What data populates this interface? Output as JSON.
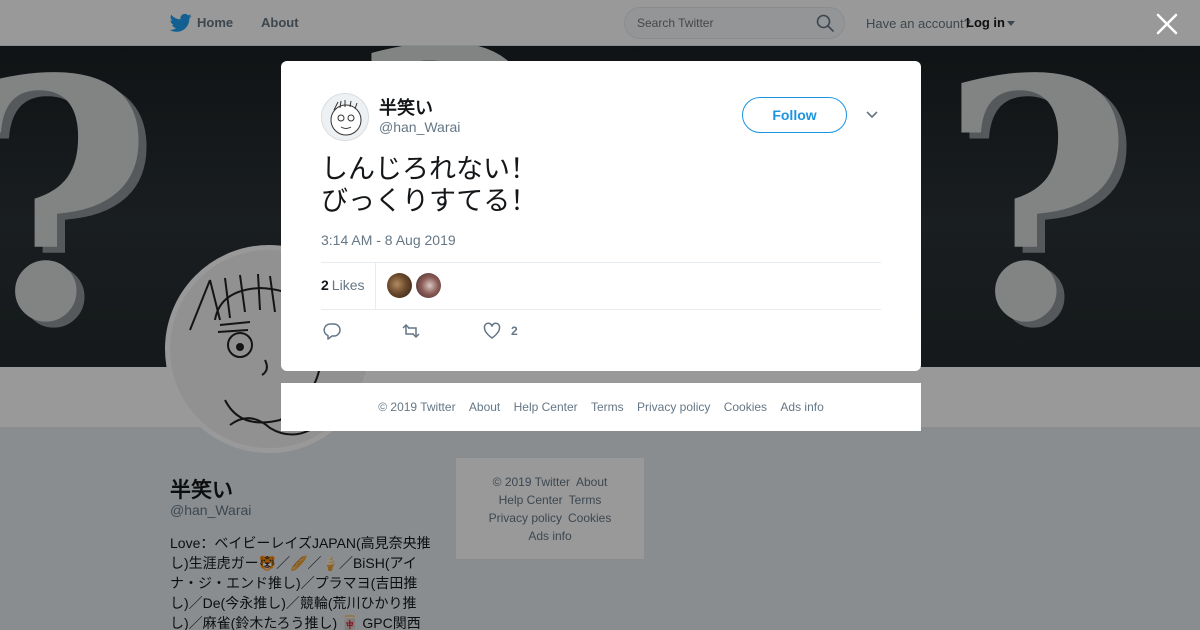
{
  "nav": {
    "home": "Home",
    "about": "About",
    "search_placeholder": "Search Twitter",
    "have_account": "Have an account?",
    "login": "Log in"
  },
  "profile": {
    "name": "半笑い",
    "handle": "@han_Warai",
    "bio": "Love：ベイビーレイズJAPAN(高見奈央推し)生涯虎ガー🐯／🥖／🍦／BiSH(アイナ・ジ・エンド推し)／プラマヨ(吉田推し)／De(今永推し)／競輪(荒川ひかり推し)／麻雀(鈴木たろう推し) 🀄 GPC関西"
  },
  "side_footer": {
    "row1": [
      "© 2019 Twitter",
      "About"
    ],
    "row2": [
      "Help Center",
      "Terms"
    ],
    "row3": [
      "Privacy policy",
      "Cookies"
    ],
    "row4": [
      "Ads info"
    ]
  },
  "tweet": {
    "name": "半笑い",
    "handle": "@han_Warai",
    "follow_label": "Follow",
    "text_line1": "しんじろれない！",
    "text_line2": "びっくりすてる！",
    "timestamp": "3:14 AM - 8 Aug 2019",
    "likes_count": "2",
    "likes_label": "Likes",
    "like_action_count": "2"
  },
  "modal_footer": {
    "copyright": "© 2019 Twitter",
    "about": "About",
    "help": "Help Center",
    "terms": "Terms",
    "privacy": "Privacy policy",
    "cookies": "Cookies",
    "ads": "Ads info"
  },
  "icons": {
    "nav_logo": "twitter-bird-icon",
    "search": "search-icon",
    "close": "close-icon",
    "reply": "reply-icon",
    "retweet": "retweet-icon",
    "like": "heart-icon",
    "more": "chevron-down-icon"
  },
  "colors": {
    "brand": "#1da1f2",
    "follow": "#1b95e0",
    "page_bg": "#e6ecf0"
  }
}
